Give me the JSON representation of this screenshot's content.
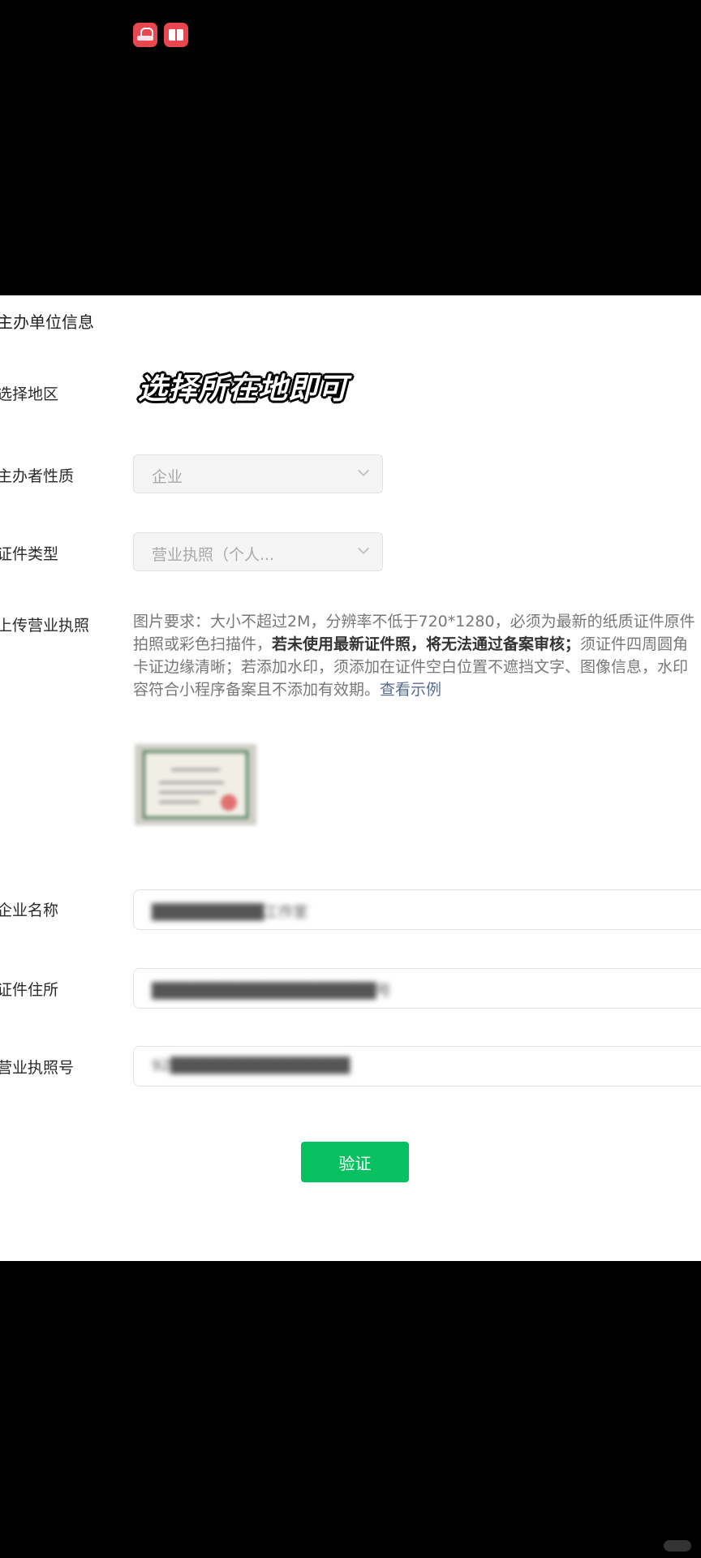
{
  "section_title": "主办单位信息",
  "overlay_caption": "选择所在地即可",
  "fields": {
    "region_label": "选择地区",
    "nature_label": "主办者性质",
    "nature_value": "企业",
    "cert_type_label": "证件类型",
    "cert_type_value": "营业执照（个人...",
    "upload_label": "上传营业执照",
    "company_name_label": "企业名称",
    "company_name_value": "██████████工作室",
    "cert_address_label": "证件住所",
    "cert_address_value": "████████████████████号",
    "license_no_label": "营业执照号",
    "license_no_value": "92████████████████"
  },
  "upload_desc": {
    "line1": "图片要求：大小不超过2M，分辨率不低于720*1280，必须为最新的纸质证件原件",
    "line2_a": "拍照或彩色扫描件，",
    "line2_bold": "若未使用最新证件照，将无法通过备案审核；",
    "line2_b": "须证件四周圆角",
    "line3": "卡证边缘清晰；若添加水印，须添加在证件空白位置不遮挡文字、图像信息，水印",
    "line4_a": "容符合小程序备案且不添加有效期。",
    "line4_link": "查看示例"
  },
  "verify_button": "验证",
  "icons": [
    "shopping-app-icon",
    "reading-app-icon"
  ],
  "colors": {
    "primary": "#07c160",
    "link": "#576b95"
  }
}
